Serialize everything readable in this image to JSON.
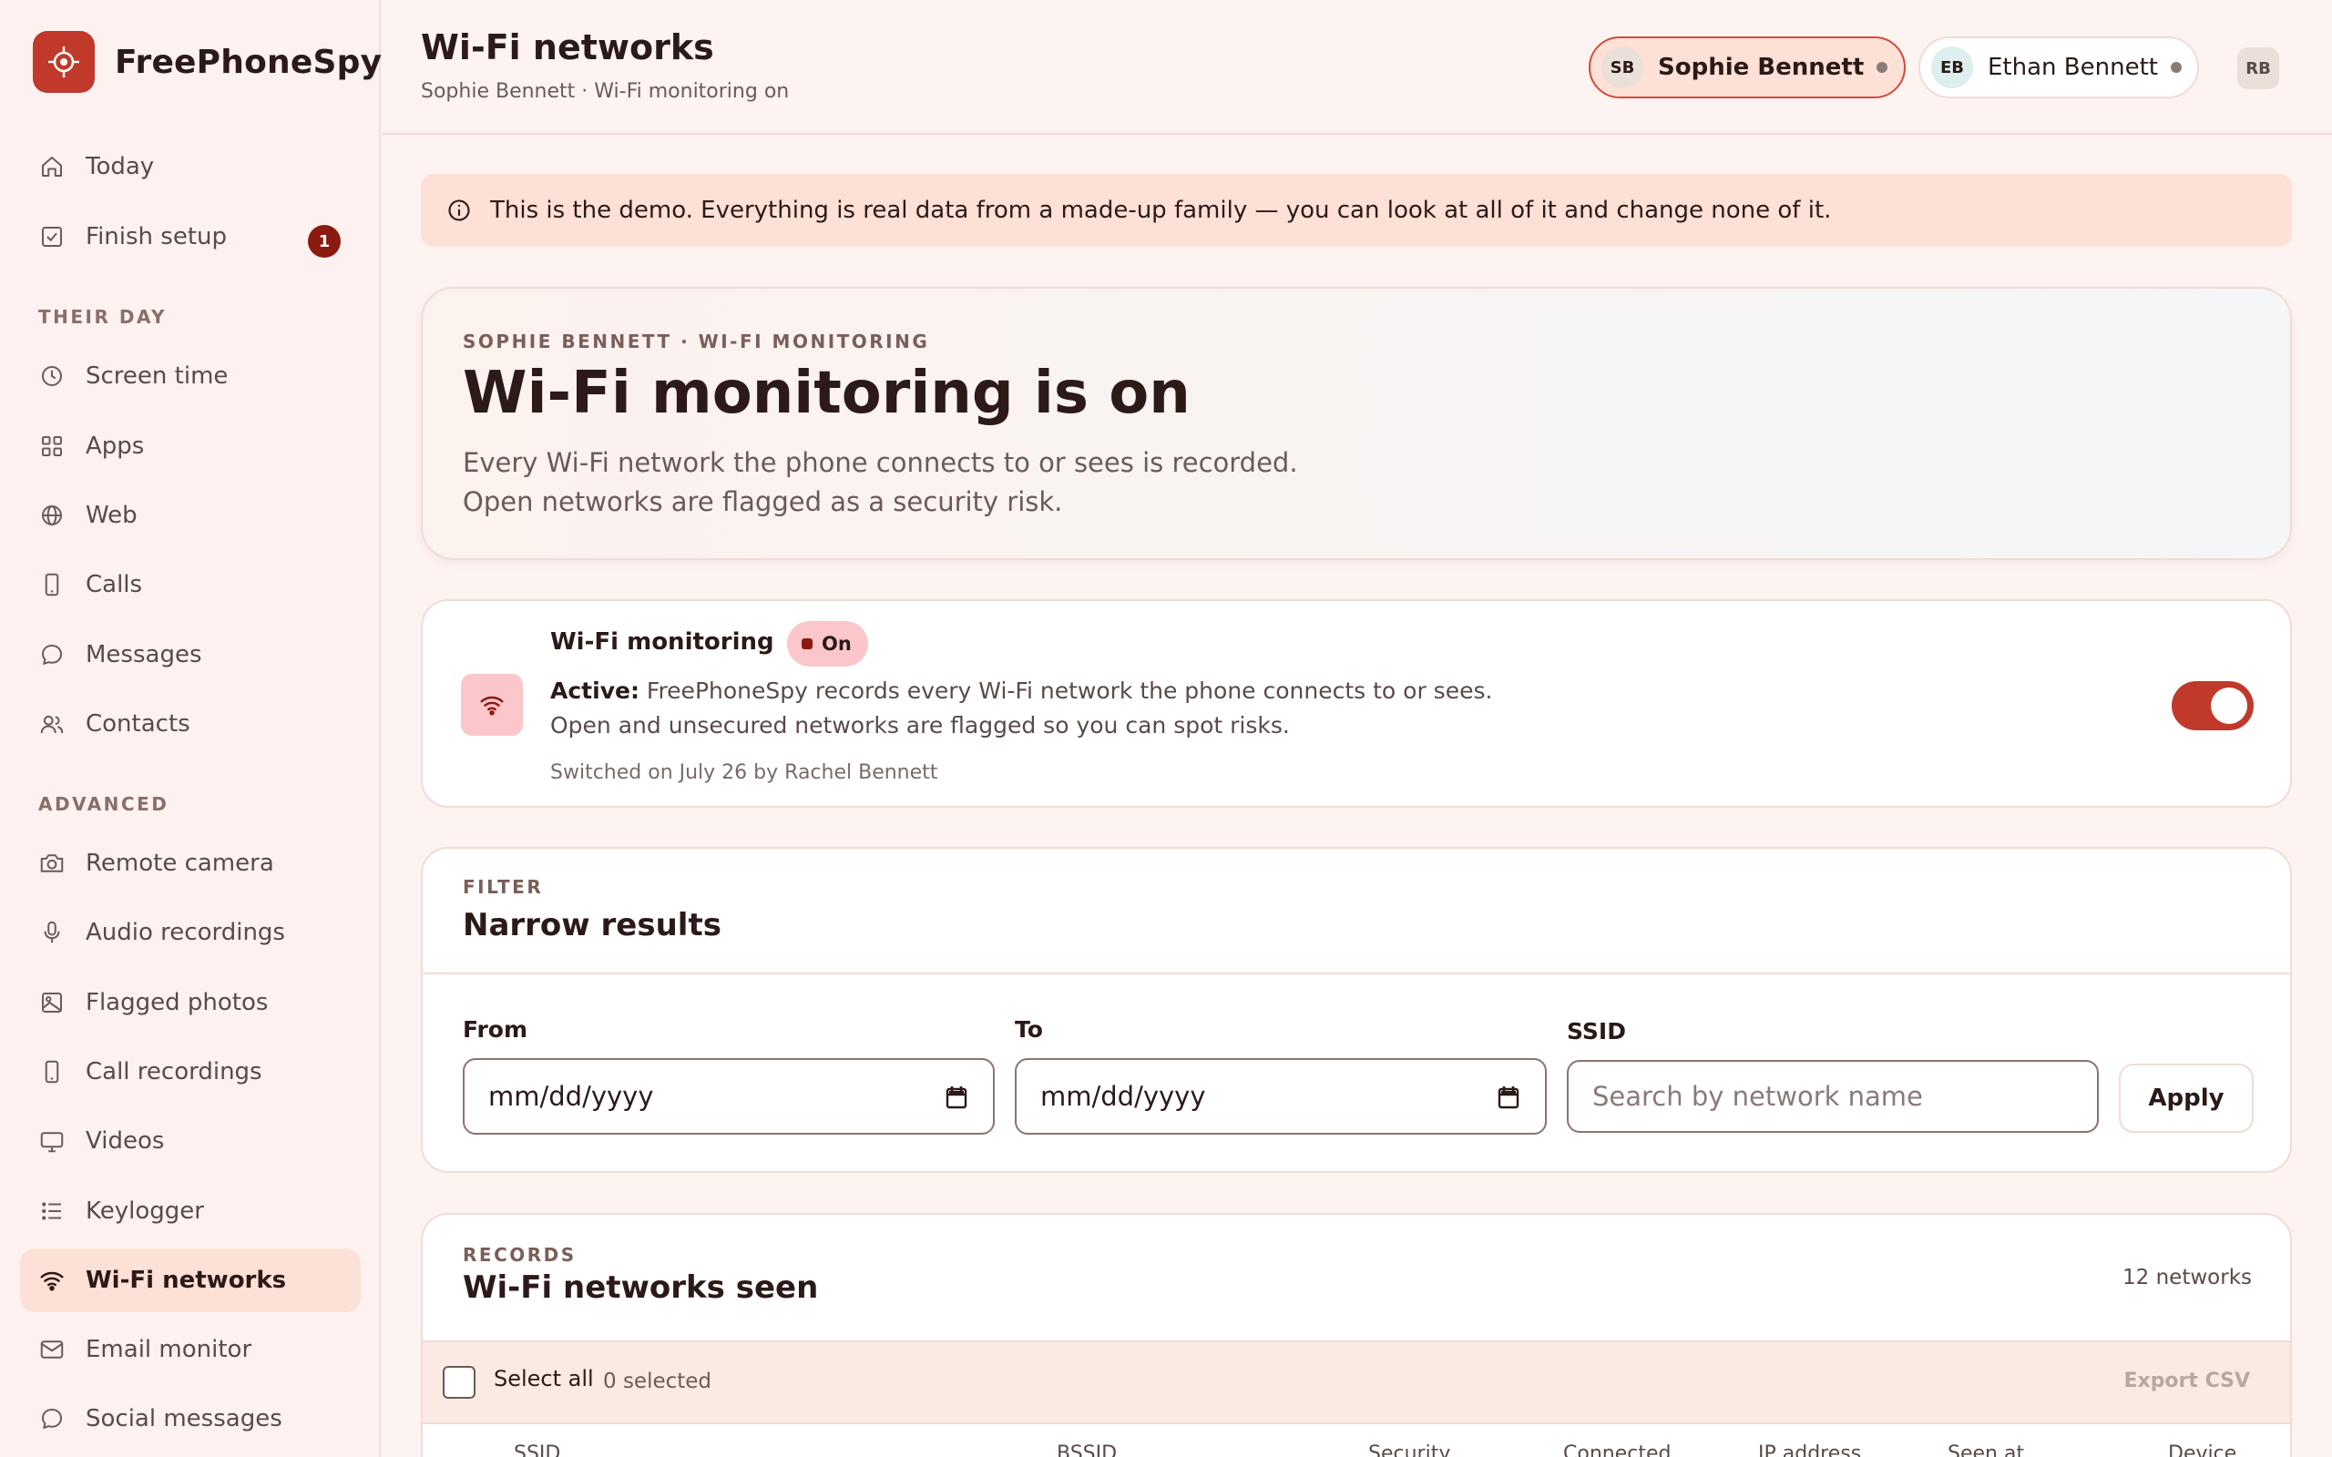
{
  "brand": {
    "name": "FreePhoneSpy",
    "accent": "#c0392b"
  },
  "sidebar": {
    "top_items": [
      {
        "label": "Today",
        "icon": "home-icon"
      },
      {
        "label": "Finish setup",
        "icon": "checkbox-icon",
        "badge": "1"
      }
    ],
    "sections": [
      {
        "title": "THEIR DAY",
        "items": [
          {
            "label": "Screen time",
            "icon": "clock-icon"
          },
          {
            "label": "Apps",
            "icon": "grid-icon"
          },
          {
            "label": "Web",
            "icon": "globe-icon"
          },
          {
            "label": "Calls",
            "icon": "phone-icon"
          },
          {
            "label": "Messages",
            "icon": "chat-icon"
          },
          {
            "label": "Contacts",
            "icon": "users-icon"
          }
        ]
      },
      {
        "title": "ADVANCED",
        "items": [
          {
            "label": "Remote camera",
            "icon": "camera-icon"
          },
          {
            "label": "Audio recordings",
            "icon": "mic-icon"
          },
          {
            "label": "Flagged photos",
            "icon": "image-icon"
          },
          {
            "label": "Call recordings",
            "icon": "phone-icon"
          },
          {
            "label": "Videos",
            "icon": "monitor-icon"
          },
          {
            "label": "Keylogger",
            "icon": "list-icon"
          },
          {
            "label": "Wi-Fi networks",
            "icon": "wifi-icon",
            "active": true
          },
          {
            "label": "Email monitor",
            "icon": "mail-icon"
          },
          {
            "label": "Social messages",
            "icon": "chat-icon"
          }
        ]
      }
    ]
  },
  "header": {
    "title": "Wi-Fi networks",
    "subtitle": "Sophie Bennett · Wi-Fi monitoring on",
    "profiles": [
      {
        "initials": "SB",
        "name": "Sophie Bennett",
        "active": true
      },
      {
        "initials": "EB",
        "name": "Ethan Bennett",
        "active": false
      }
    ],
    "user_initials": "RB"
  },
  "banner": {
    "text": "This is the demo. Everything is real data from a made-up family — you can look at all of it and change none of it."
  },
  "hero": {
    "eyebrow": "SOPHIE BENNETT · WI-FI MONITORING",
    "title": "Wi-Fi monitoring is on",
    "line1": "Every Wi-Fi network the phone connects to or sees is recorded.",
    "line2": "Open networks are flagged as a security risk."
  },
  "status_card": {
    "title": "Wi-Fi monitoring",
    "pill": "On",
    "active_label": "Active:",
    "description": "FreePhoneSpy records every Wi-Fi network the phone connects to or sees. Open and unsecured networks are flagged so you can spot risks.",
    "meta": "Switched on July 26 by Rachel Bennett",
    "toggle_on": true
  },
  "filter": {
    "eyebrow": "FILTER",
    "title": "Narrow results",
    "from_label": "From",
    "to_label": "To",
    "ssid_label": "SSID",
    "date_placeholder": "mm/dd/yyyy",
    "ssid_placeholder": "Search by network name",
    "apply_label": "Apply"
  },
  "records": {
    "eyebrow": "RECORDS",
    "title": "Wi-Fi networks seen",
    "count": "12 networks",
    "select_all": "Select all",
    "selected": "0 selected",
    "export": "Export CSV",
    "columns": [
      "SSID",
      "BSSID",
      "Security",
      "Connected",
      "IP address",
      "Seen at",
      "Device"
    ]
  }
}
